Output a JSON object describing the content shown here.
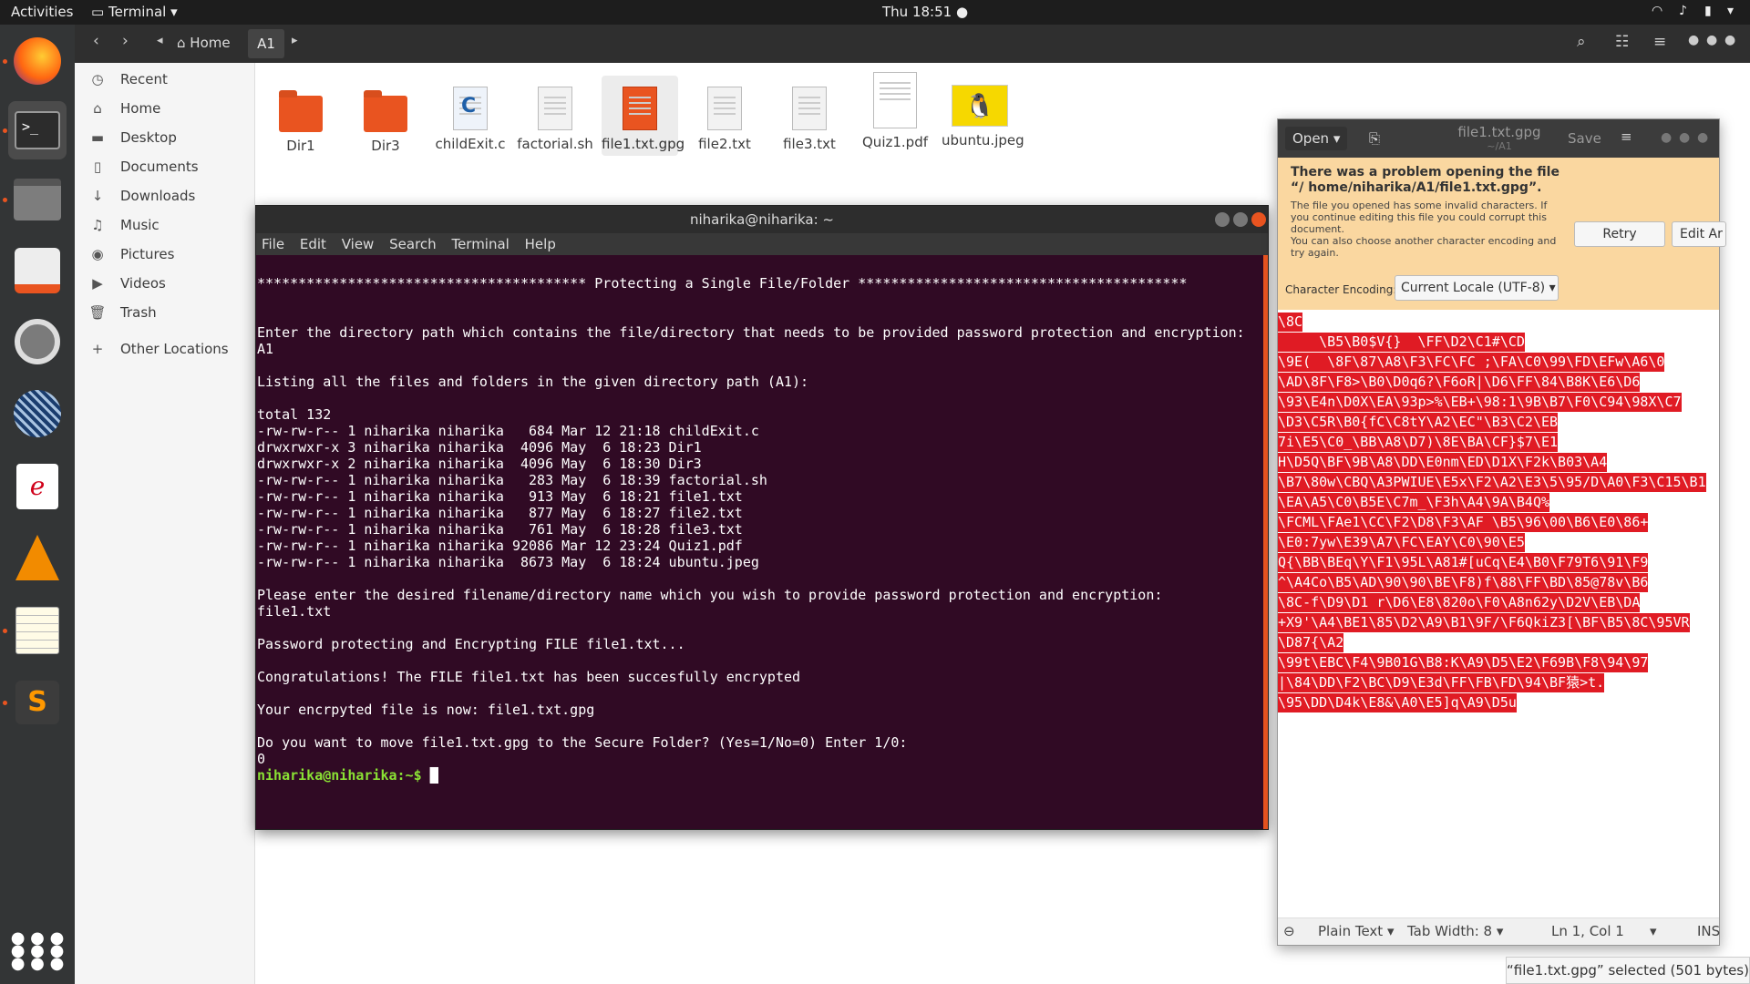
{
  "topbar": {
    "activities": "Activities",
    "app_menu": "Terminal",
    "clock": "Thu 18:51"
  },
  "fm": {
    "breadcrumb": {
      "home": "Home",
      "current": "A1"
    },
    "sidebar": [
      {
        "label": "Recent",
        "icon": "clock-icon"
      },
      {
        "label": "Home",
        "icon": "home-icon"
      },
      {
        "label": "Desktop",
        "icon": "folder-icon"
      },
      {
        "label": "Documents",
        "icon": "document-icon"
      },
      {
        "label": "Downloads",
        "icon": "download-icon"
      },
      {
        "label": "Music",
        "icon": "music-icon"
      },
      {
        "label": "Pictures",
        "icon": "camera-icon"
      },
      {
        "label": "Videos",
        "icon": "video-icon"
      },
      {
        "label": "Trash",
        "icon": "trash-icon"
      },
      {
        "label": "Other Locations",
        "icon": "plus-icon"
      }
    ],
    "files": [
      {
        "name": "Dir1",
        "kind": "folder"
      },
      {
        "name": "Dir3",
        "kind": "folder"
      },
      {
        "name": "childExit.c",
        "kind": "c-source"
      },
      {
        "name": "factorial.sh",
        "kind": "script"
      },
      {
        "name": "file1.txt.gpg",
        "kind": "gpg"
      },
      {
        "name": "file2.txt",
        "kind": "text"
      },
      {
        "name": "file3.txt",
        "kind": "text"
      },
      {
        "name": "Quiz1.pdf",
        "kind": "pdf"
      },
      {
        "name": "ubuntu.jpeg",
        "kind": "image"
      }
    ],
    "selection_status": "“file1.txt.gpg” selected (501 bytes)"
  },
  "terminal": {
    "title": "niharika@niharika: ~",
    "menu": [
      "File",
      "Edit",
      "View",
      "Search",
      "Terminal",
      "Help"
    ],
    "lines": [
      "",
      "**************************************** Protecting a Single File/Folder ****************************************",
      "",
      "",
      "Enter the directory path which contains the file/directory that needs to be provided password protection and encryption:",
      "A1",
      "",
      "Listing all the files and folders in the given directory path (A1):",
      "",
      "total 132",
      "-rw-rw-r-- 1 niharika niharika   684 Mar 12 21:18 childExit.c",
      "drwxrwxr-x 3 niharika niharika  4096 May  6 18:23 Dir1",
      "drwxrwxr-x 2 niharika niharika  4096 May  6 18:30 Dir3",
      "-rw-rw-r-- 1 niharika niharika   283 May  6 18:39 factorial.sh",
      "-rw-rw-r-- 1 niharika niharika   913 May  6 18:21 file1.txt",
      "-rw-rw-r-- 1 niharika niharika   877 May  6 18:27 file2.txt",
      "-rw-rw-r-- 1 niharika niharika   761 May  6 18:28 file3.txt",
      "-rw-rw-r-- 1 niharika niharika 92086 Mar 12 23:24 Quiz1.pdf",
      "-rw-rw-r-- 1 niharika niharika  8673 May  6 18:24 ubuntu.jpeg",
      "",
      "Please enter the desired filename/directory name which you wish to provide password protection and encryption:",
      "file1.txt",
      "",
      "Password protecting and Encrypting FILE file1.txt...",
      "",
      "Congratulations! The FILE file1.txt has been succesfully encrypted",
      "",
      "Your encrpyted file is now: file1.txt.gpg",
      "",
      "Do you want to move file1.txt.gpg to the Secure Folder? (Yes=1/No=0) Enter 1/0:",
      "0"
    ],
    "prompt": "niharika@niharika:~$"
  },
  "gedit": {
    "open_label": "Open",
    "title": "file1.txt.gpg",
    "subtitle": "~/A1",
    "save_label": "Save",
    "error_title": "There was a problem opening the file “/ home/niharika/A1/file1.txt.gpg”.",
    "error_body": "The file you opened has some invalid characters. If you continue editing this file you could corrupt this document.\nYou can also choose another character encoding and try again.",
    "retry_label": "Retry",
    "edit_anyway_label": "Edit Ar",
    "encoding_label": "Character Encoding:",
    "encoding_value": "Current Locale (UTF-8)",
    "garbled_lines": [
      "\\8C",
      "     \\B5\\B0$V{}  \\FF\\D2\\C1#\\CD",
      "\\9E(  \\8F\\87\\A8\\F3\\FC\\FC ;\\FA\\C0\\99\\FD\\EFw\\A6\\0",
      "\\AD\\8F\\F8>\\B0\\D0q6?\\F6oR|\\D6\\FF\\84\\B8K\\E6\\D6",
      "\\93\\E4n\\D0X\\EA\\93p>%\\EB+\\98:1\\9B\\B7\\F0\\C94\\98X\\C7",
      "\\D3\\C5R\\B0{fC\\C8tY\\A2\\EC\"\\B3\\C2\\EB",
      "7i\\E5\\C0_\\BB\\A8\\D7)\\8E\\BA\\CF}$7\\E1",
      "H\\D5Q\\BF\\9B\\A8\\DD\\E0nm\\ED\\D1X\\F2k\\B03\\A4",
      "\\B7\\80w\\CBQ\\A3PWIUE\\E5x\\F2\\A2\\E3\\5\\95/D\\A0\\F3\\C15\\B1",
      "\\EA\\A5\\C0\\B5E\\C7m_\\F3h\\A4\\9A\\B4Q%",
      "\\FCML\\FAe1\\CC\\F2\\D8\\F3\\AF \\B5\\96\\00\\B6\\E0\\86+",
      "\\E0:7yw\\E39\\A7\\FC\\EAY\\C0\\90\\E5",
      "Q{\\BB\\BEq\\Y\\F1\\95L\\A81#[uCq\\E4\\B0\\F79T6\\91\\F9",
      "^\\A4Co\\B5\\AD\\90\\90\\BE\\F8)f\\88\\FF\\BD\\85@78v\\B6",
      "\\8C-f\\D9\\D1 r\\D6\\E8\\820o\\F0\\A8n62y\\D2V\\EB\\DA",
      "+X9'\\A4\\BE1\\85\\D2\\A9\\B1\\9F/\\F6QkiZ3[\\BF\\B5\\8C\\95VR",
      "\\D87{\\A2",
      "\\99t\\EBC\\F4\\9B01G\\B8:K\\A9\\D5\\E2\\F69B\\F8\\94\\97",
      "|\\84\\DD\\F2\\BC\\D9\\E3d\\FF\\FB\\FD\\94\\BF猿>t.",
      "\\95\\DD\\D4k\\E8&\\A0\\E5]q\\A9\\D5u"
    ],
    "status": {
      "mode": "Plain Text",
      "tab_width": "Tab Width: 8",
      "position": "Ln 1, Col 1",
      "ins": "INS"
    }
  }
}
